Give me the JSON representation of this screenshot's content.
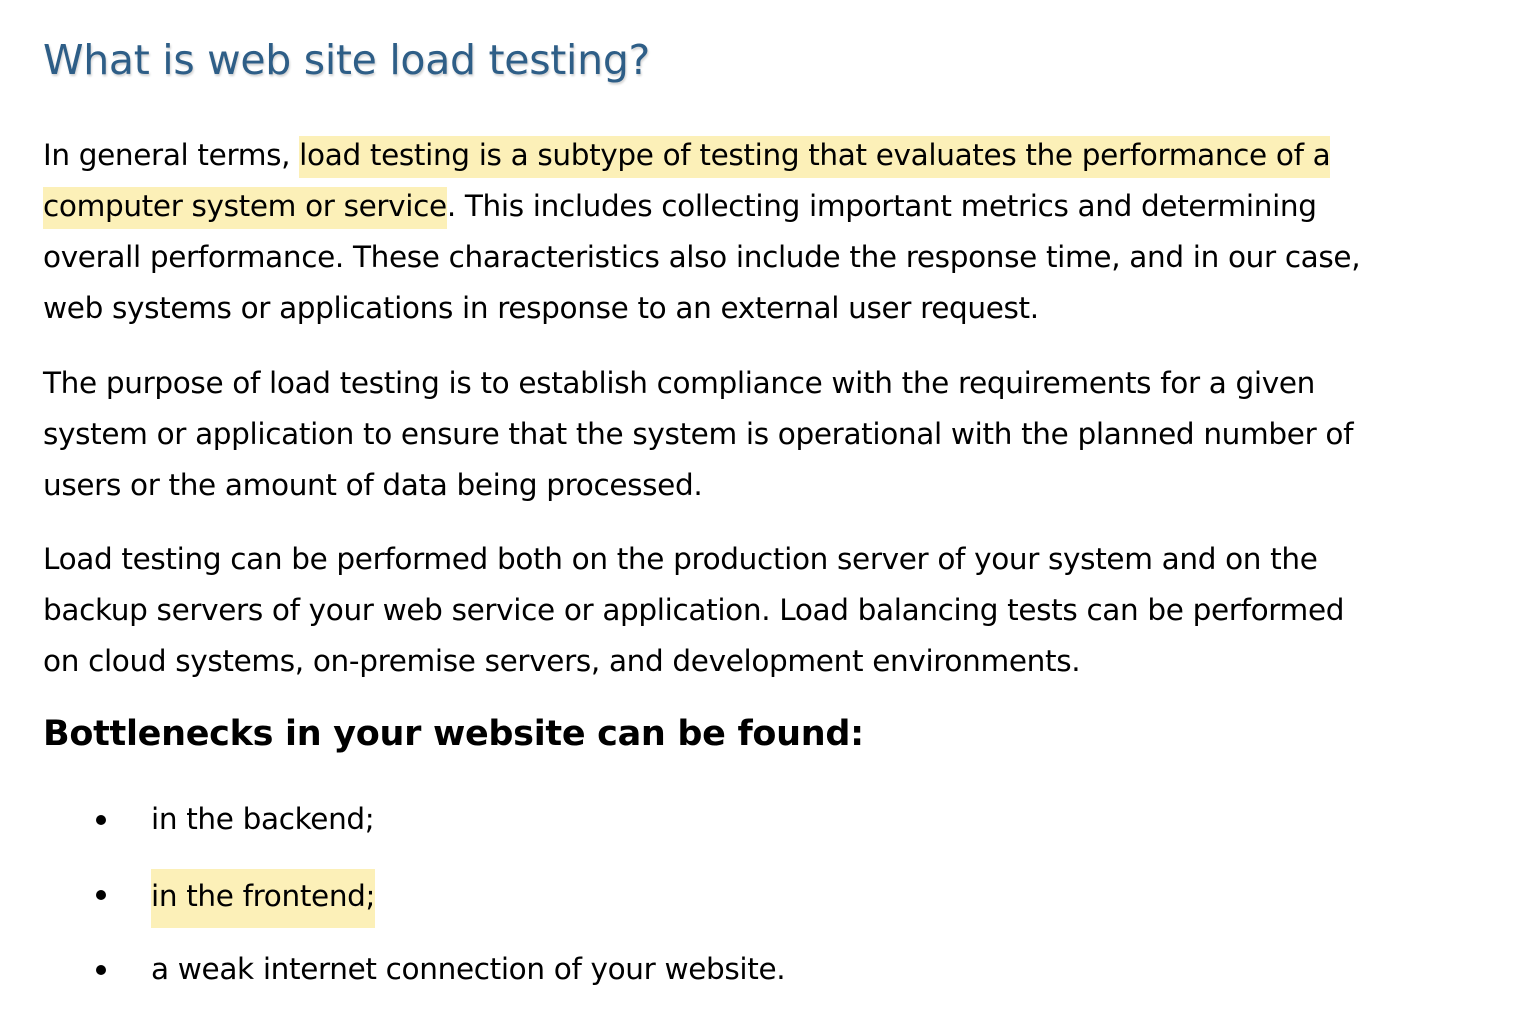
{
  "doc": {
    "title": "What is web site load testing?",
    "paragraph1": {
      "line1_prefix": "In general terms, ",
      "line1_highlight": "load testing is a subtype of testing that evaluates the performance of a",
      "line2_highlight": "computer system or service",
      "line2_suffix": ". This includes collecting important metrics and determining",
      "line3": "overall performance. These characteristics also include the response time, and in our case,",
      "line4": "web systems or applications in response to an external user request."
    },
    "paragraph2": {
      "line1": "The purpose of load testing is to establish compliance with the requirements for a given",
      "line2": "system or application to ensure that the system is operational with the planned number of",
      "line3": "users or the amount of data being processed."
    },
    "paragraph3": {
      "line1": "Load testing can be performed both on the production server of your system and on the",
      "line2": "backup servers of your web service or application. Load balancing tests can be performed",
      "line3": "on cloud systems, on-premise servers, and development environments."
    },
    "subheading": "Bottlenecks in your website can be found:",
    "bullets": [
      "in the backend;",
      "in the frontend;",
      "a weak internet connection of your website."
    ],
    "colors": {
      "title": "#2e5e87",
      "highlight": "#fcf0b8",
      "text": "#000000"
    }
  }
}
